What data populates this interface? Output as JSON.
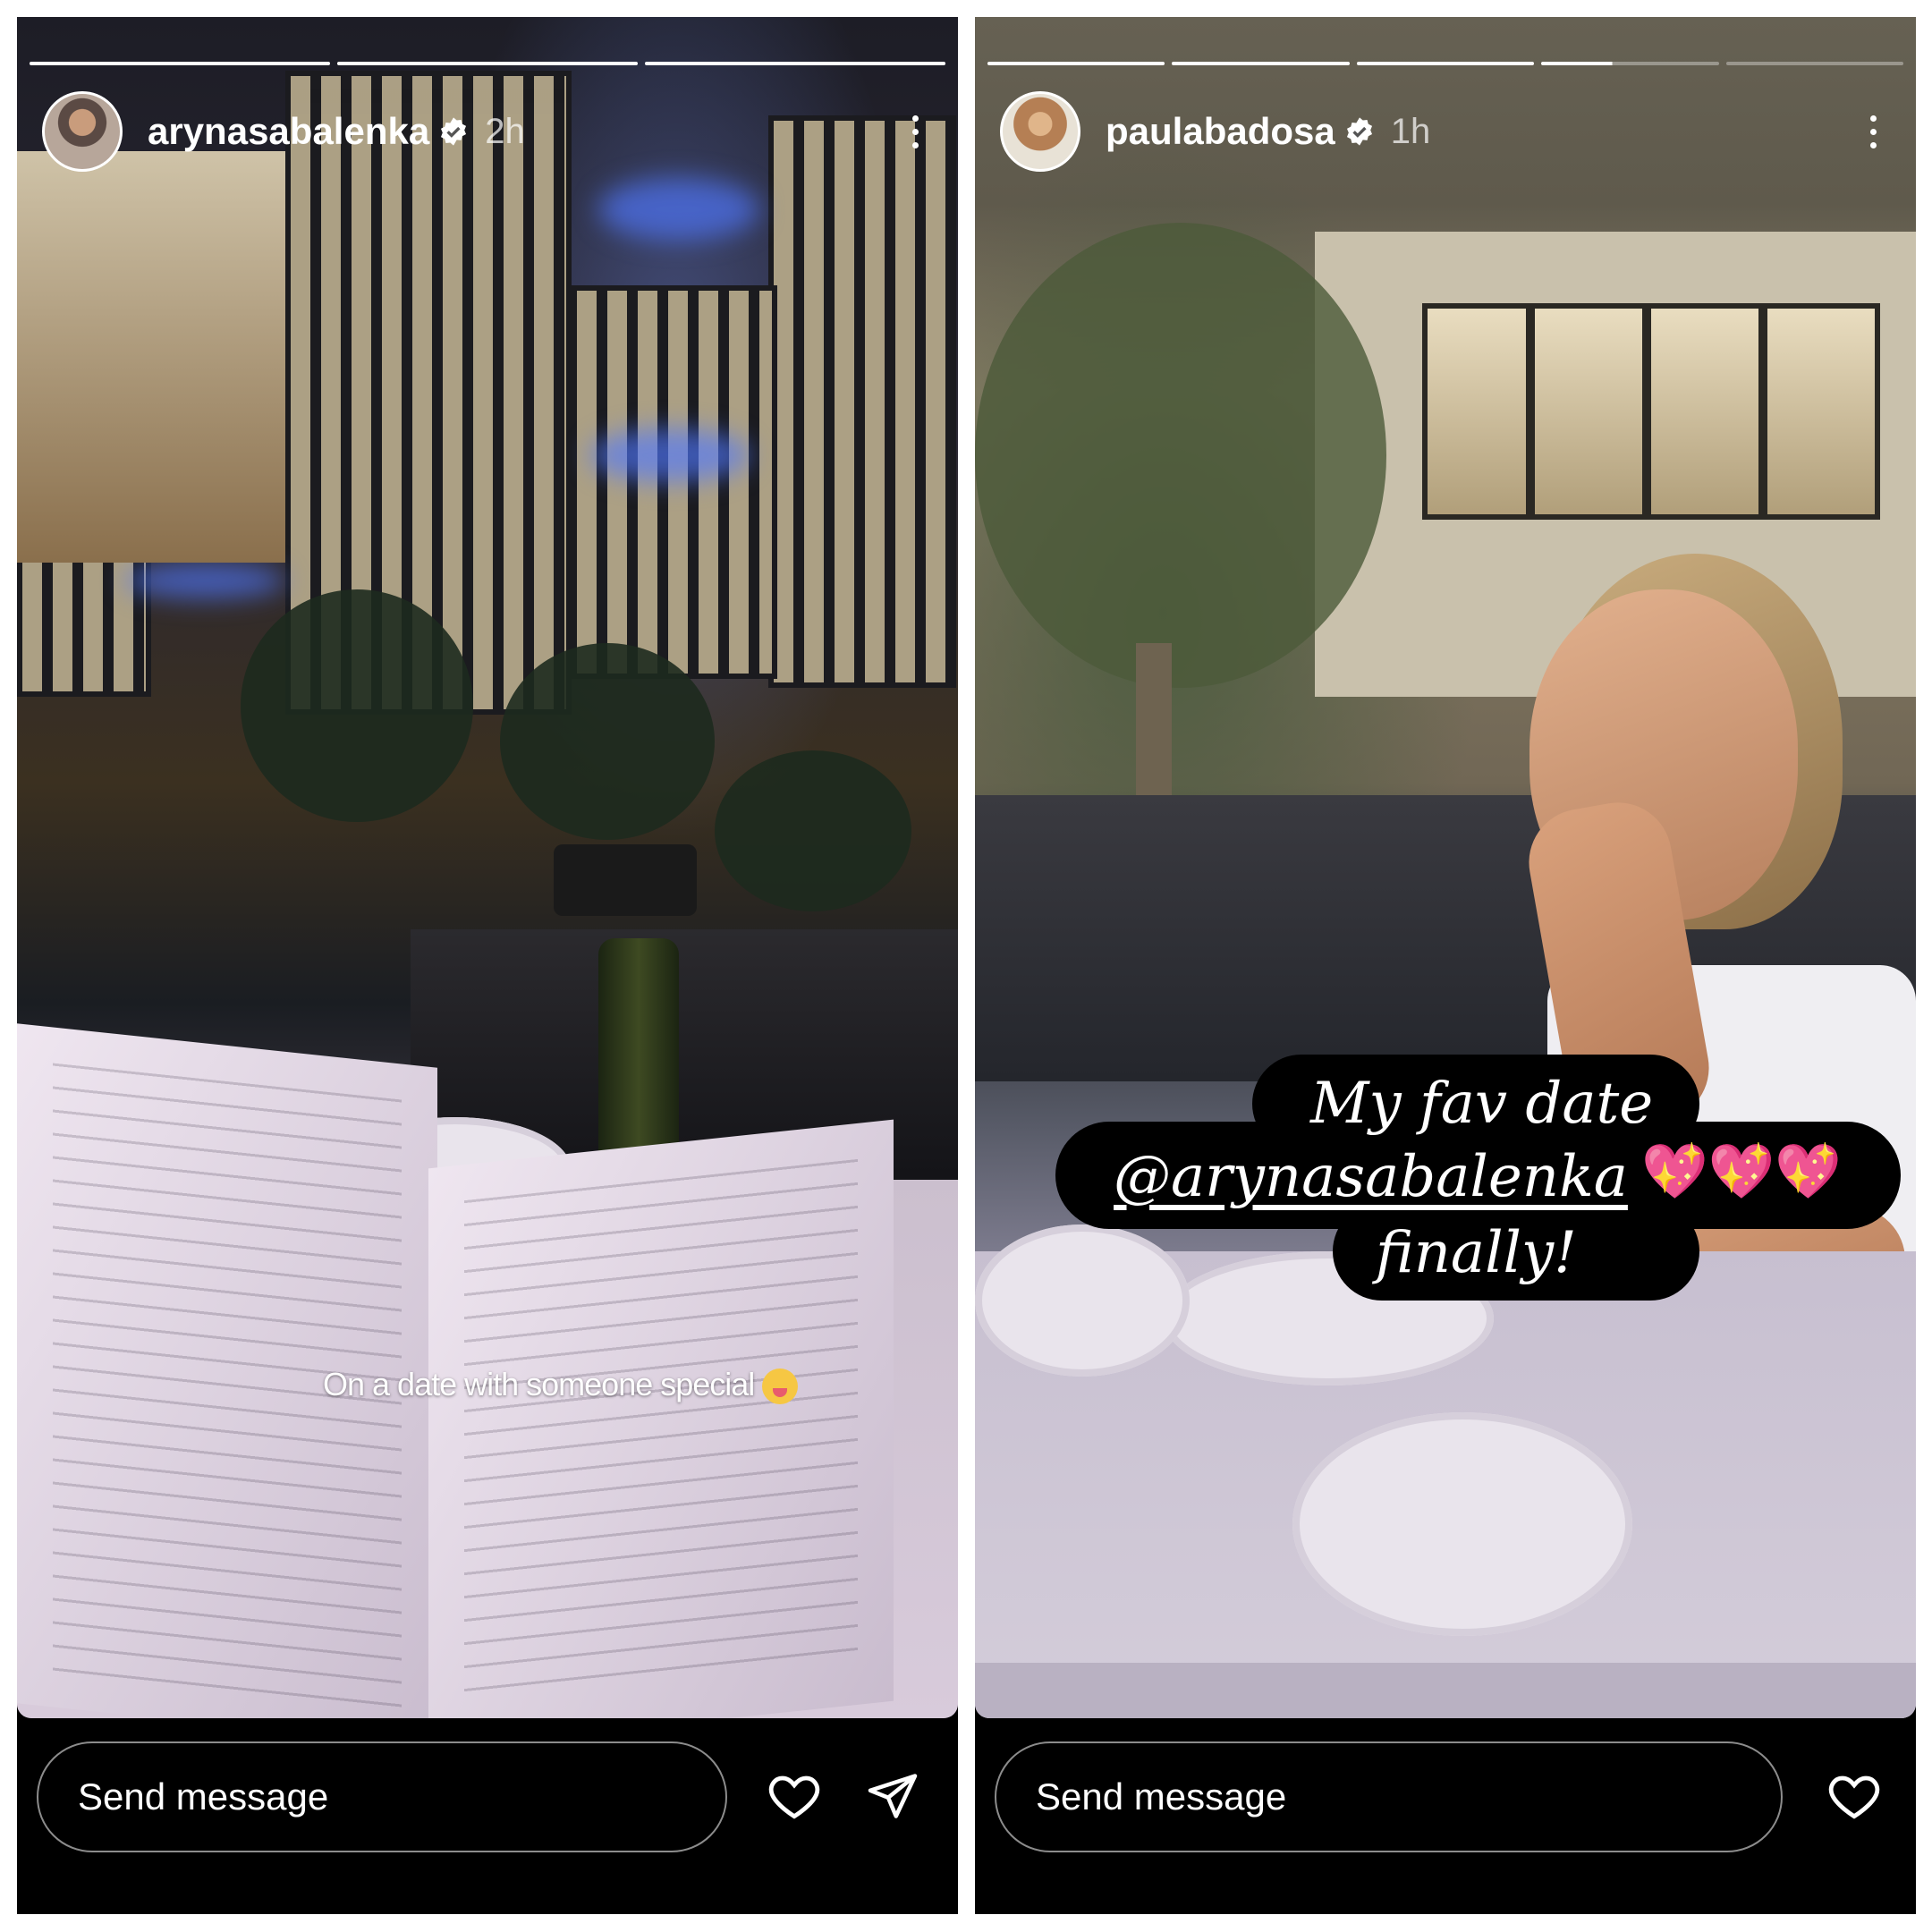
{
  "stories": [
    {
      "username": "arynasabalenka",
      "time": "2h",
      "caption": "On a date with someone special",
      "caption_emoji": "squinting-face-with-tongue",
      "progress": {
        "total": 3,
        "current": 3
      },
      "send_placeholder": "Send message",
      "actions": [
        "heart-icon",
        "send-icon"
      ]
    },
    {
      "username": "paulabadosa",
      "time": "1h",
      "sticker": {
        "line1": "My fav date",
        "line2": "@arynasabalenka",
        "hearts": "💖💖💖",
        "line3": "finally!"
      },
      "progress": {
        "total": 5,
        "current": 4
      },
      "send_placeholder": "Send message",
      "actions": [
        "heart-icon"
      ]
    }
  ],
  "colors": {
    "background": "#000000",
    "text": "#ffffff",
    "verified": "#ffffff"
  }
}
